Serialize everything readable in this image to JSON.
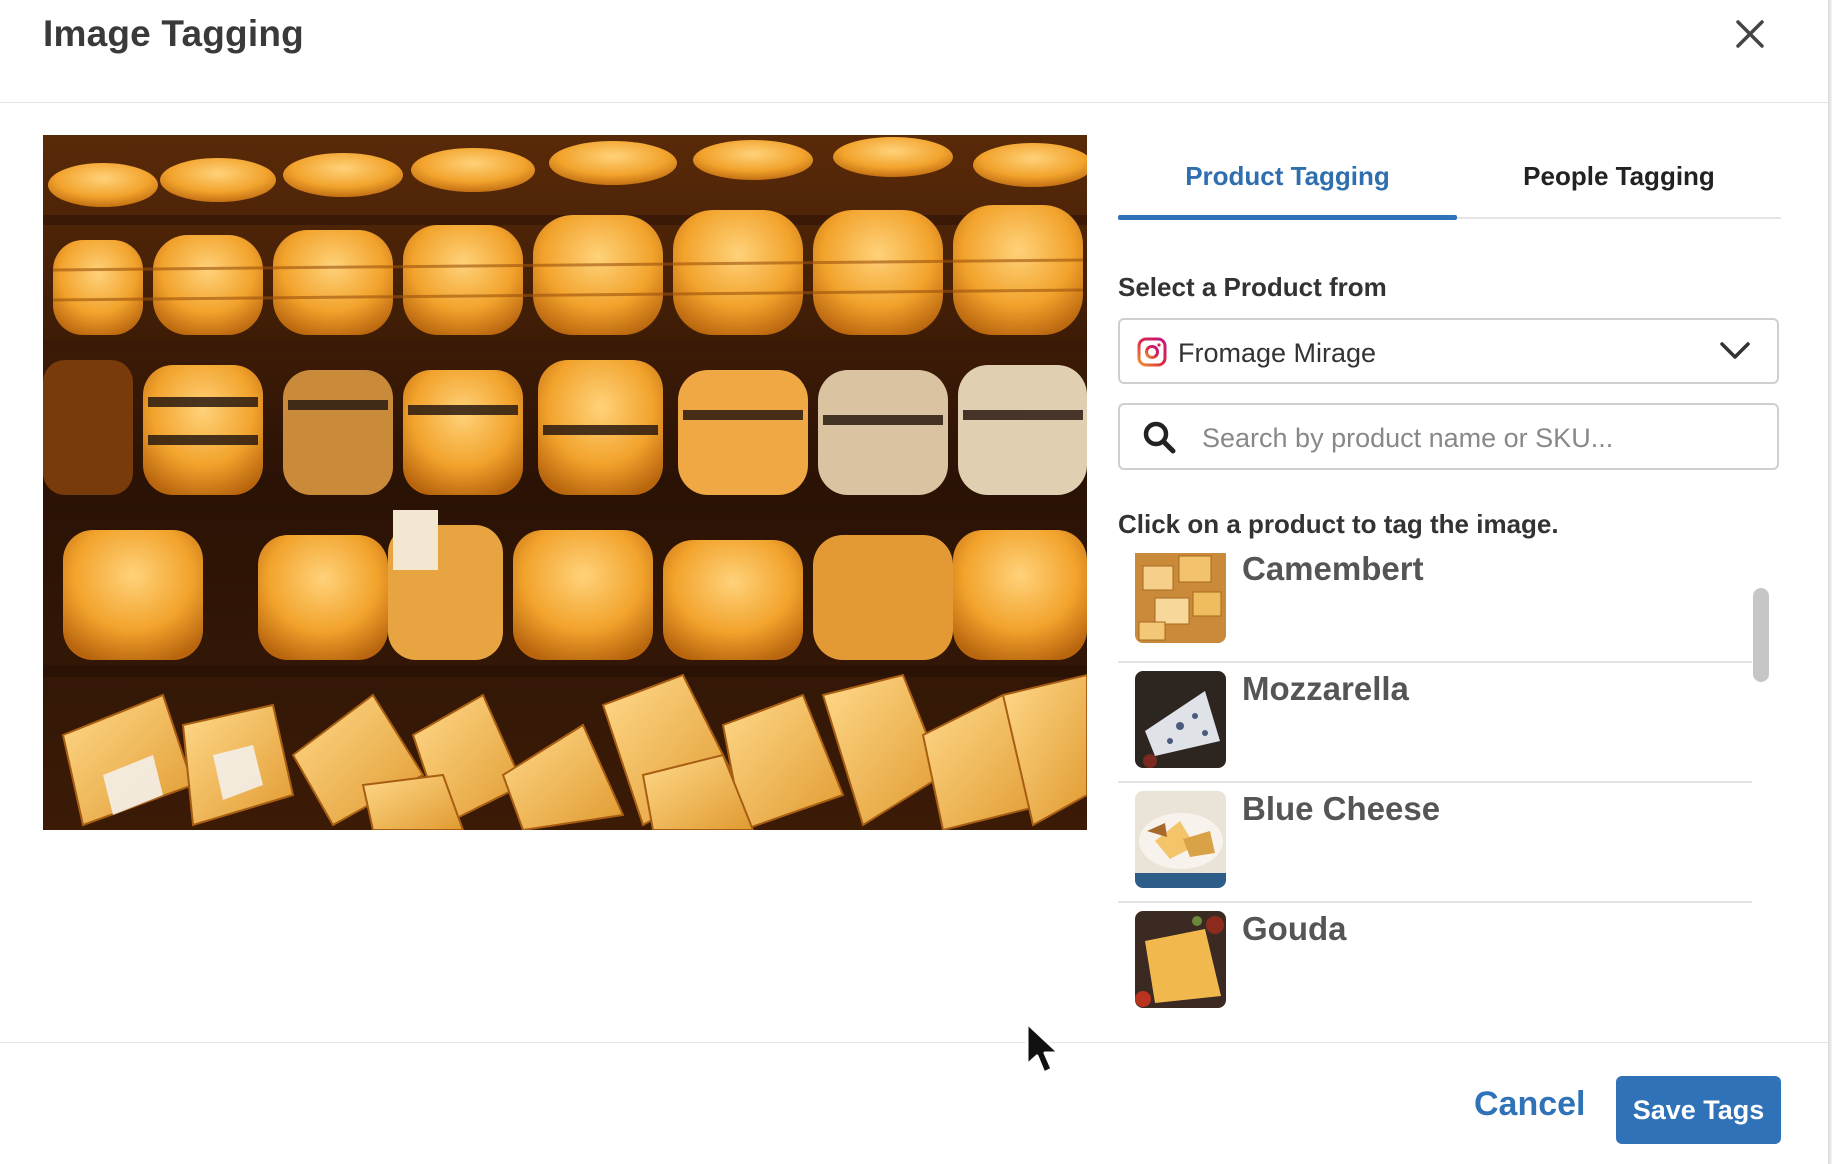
{
  "dialog": {
    "title": "Image Tagging",
    "close_icon": "close-icon"
  },
  "photo": {
    "description_icon": "cheese-shop-photo"
  },
  "tabs": [
    {
      "label": "Product Tagging",
      "active": true
    },
    {
      "label": "People Tagging",
      "active": false
    }
  ],
  "source": {
    "label": "Select a Product from",
    "selected": "Fromage Mirage",
    "icon": "instagram-icon",
    "accent": "#e1306c"
  },
  "search": {
    "placeholder": "Search by product name or SKU...",
    "value": ""
  },
  "hint": "Click on a product to tag the image.",
  "products": [
    {
      "name": "Camembert",
      "thumb": "cheese-cubes-thumb"
    },
    {
      "name": "Mozzarella",
      "thumb": "blue-cheese-wedge-thumb"
    },
    {
      "name": "Blue Cheese",
      "thumb": "cheese-board-thumb"
    },
    {
      "name": "Gouda",
      "thumb": "cheese-slice-thumb"
    }
  ],
  "footer": {
    "cancel_label": "Cancel",
    "save_label": "Save Tags"
  },
  "colors": {
    "accent": "#2f72b7",
    "active_tab": "#2f6fae"
  }
}
